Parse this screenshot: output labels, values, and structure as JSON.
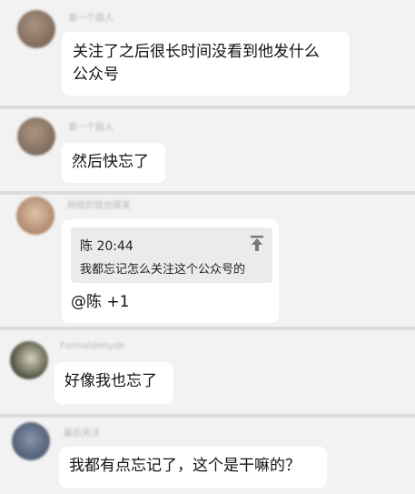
{
  "messages": [
    {
      "sender": "第一个路人",
      "avatar_color": "#8a7466",
      "text_line1": "关注了之后很长时间没看到他发什么",
      "text_line2": "公众号"
    },
    {
      "sender": "第一个路人",
      "avatar_color": "#8c7668",
      "text": "然后快忘了"
    },
    {
      "sender": "网络的我也模某",
      "avatar_color": "#c89a7a",
      "quote": {
        "author_time": "陈 20:44",
        "text": "我都忘记怎么关注这个公众号的",
        "icon": "pin-top-icon"
      },
      "text": "@陈 +1"
    },
    {
      "sender": "Formaldehyde",
      "avatar_color": "#5a5e4a",
      "text": "好像我也忘了"
    },
    {
      "sender": "最后关注",
      "avatar_color": "#4b5a72",
      "text": "我都有点忘记了，这个是干嘛的？"
    }
  ]
}
